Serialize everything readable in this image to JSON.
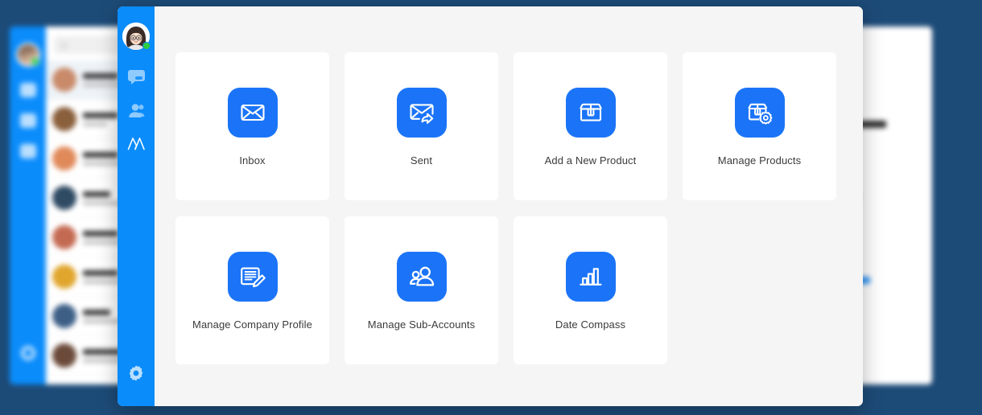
{
  "theme": {
    "page_background": "#1d4b78",
    "rail_blue": "#0a8cfb",
    "icon_blue": "#1b74f7",
    "modal_background": "#f5f5f5",
    "card_background": "#ffffff",
    "label_color": "#3b3b3b",
    "presence_green": "#2ecc40"
  },
  "modal": {
    "rail": {
      "avatar_name": "user-avatar",
      "presence": "online",
      "items": [
        {
          "icon": "chat-bubble-icon",
          "name": "rail-item-chat"
        },
        {
          "icon": "contacts-icon",
          "name": "rail-item-contacts"
        },
        {
          "icon": "brand-m-icon",
          "name": "rail-item-brand"
        }
      ],
      "settings": {
        "icon": "gear-icon",
        "name": "rail-item-settings"
      }
    },
    "tiles": [
      {
        "label": "Inbox",
        "icon": "envelope-icon",
        "name": "tile-inbox"
      },
      {
        "label": "Sent",
        "icon": "envelope-share-icon",
        "name": "tile-sent"
      },
      {
        "label": "Add a New Product",
        "icon": "box-icon",
        "name": "tile-add-a-new-product"
      },
      {
        "label": "Manage Products",
        "icon": "box-gear-icon",
        "name": "tile-manage-products"
      },
      {
        "label": "Manage Company Profile",
        "icon": "document-pencil-icon",
        "name": "tile-manage-company-profile"
      },
      {
        "label": "Manage Sub-Accounts",
        "icon": "users-icon",
        "name": "tile-manage-sub-accounts"
      },
      {
        "label": "Date Compass",
        "icon": "bar-chart-icon",
        "name": "tile-date-compass"
      }
    ]
  },
  "background_app": {
    "rail": {
      "avatar_name": "background-user-avatar",
      "items": [
        "chat-bubble-icon",
        "contacts-icon",
        "bar-chart-icon"
      ],
      "settings_icon": "gear-icon"
    },
    "search": {
      "placeholder": "",
      "icon": "search-icon"
    },
    "conversations": [
      {
        "name": "",
        "preview": "",
        "avatar": "#c98a6a",
        "selected": true
      },
      {
        "name": "",
        "preview": "",
        "avatar": "#8a5f3c",
        "selected": false
      },
      {
        "name": "",
        "preview": "",
        "avatar": "#e08a5a",
        "selected": false
      },
      {
        "name": "",
        "preview": "",
        "avatar": "#2f4a63",
        "selected": false
      },
      {
        "name": "",
        "preview": "",
        "avatar": "#c46a52",
        "selected": false
      },
      {
        "name": "",
        "preview": "",
        "avatar": "#e0a52c",
        "selected": false
      },
      {
        "name": "",
        "preview": "",
        "avatar": "#3d5f86",
        "selected": false
      },
      {
        "name": "",
        "preview": "",
        "avatar": "#6b4a3a",
        "selected": false
      }
    ],
    "detail_fields": [
      {
        "label": "",
        "value": "",
        "value_width": "36px"
      },
      {
        "label": "",
        "value": "",
        "value_width": "100px"
      },
      {
        "label": "",
        "value": "",
        "value_width": "62px"
      },
      {
        "label": "",
        "value": "",
        "value_width": "72px"
      },
      {
        "label": "",
        "value": "",
        "value_width": "0px"
      },
      {
        "label": "",
        "value": "",
        "value_width": "42px"
      }
    ],
    "detail_chips": [
      "18px",
      "34px",
      "22px"
    ]
  }
}
